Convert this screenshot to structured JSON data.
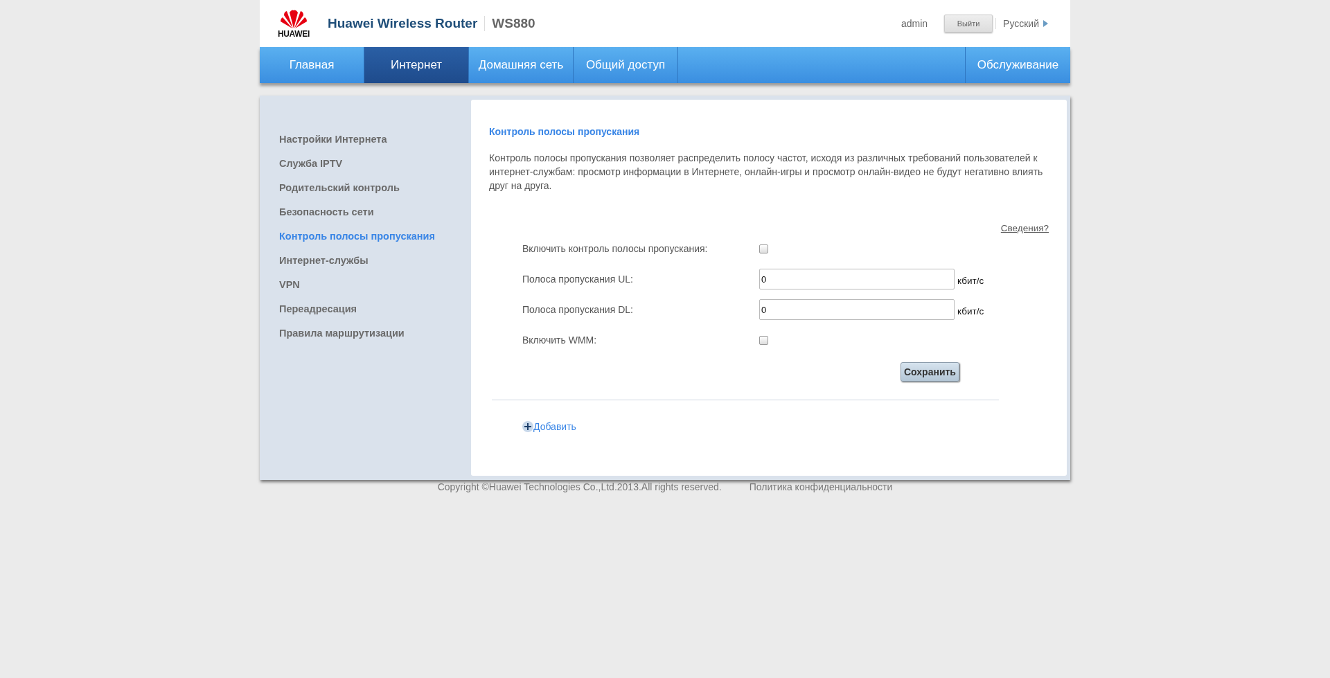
{
  "header": {
    "logo_text": "HUAWEI",
    "product": "Huawei Wireless Router",
    "model": "WS880",
    "user": "admin",
    "logout": "Выйти",
    "language": "Русский"
  },
  "tabs": [
    {
      "label": "Главная",
      "selected": false,
      "kind": "main"
    },
    {
      "label": "Интернет",
      "selected": true,
      "kind": "main"
    },
    {
      "label": "Домашняя сеть",
      "selected": false,
      "kind": "main"
    },
    {
      "label": "Общий доступ",
      "selected": false,
      "kind": "main"
    },
    {
      "label": "Обслуживание",
      "selected": false,
      "kind": "service"
    }
  ],
  "sidebar": {
    "items": [
      {
        "label": "Настройки Интернета",
        "selected": false
      },
      {
        "label": "Служба IPTV",
        "selected": false
      },
      {
        "label": "Родительский контроль",
        "selected": false
      },
      {
        "label": "Безопасность сети",
        "selected": false
      },
      {
        "label": "Контроль полосы пропускания",
        "selected": true
      },
      {
        "label": "Интернет-службы",
        "selected": false
      },
      {
        "label": "VPN",
        "selected": false
      },
      {
        "label": "Переадресация",
        "selected": false
      },
      {
        "label": "Правила маршрутизации",
        "selected": false
      }
    ]
  },
  "content": {
    "title": "Контроль полосы пропускания",
    "description": "Контроль полосы пропускания позволяет распределить полосу частот, исходя из различных требований пользователей к интернет-службам: просмотр информации в Интернете, онлайн-игры и просмотр онлайн-видео не будут негативно влиять друг на друга.",
    "help_link": "Сведения?",
    "fields": [
      {
        "kind": "checkbox",
        "label": "Включить контроль полосы пропускания:",
        "checked": false
      },
      {
        "kind": "text",
        "label": "Полоса пропускания UL:",
        "value": "0",
        "unit": "кбит/с"
      },
      {
        "kind": "text",
        "label": "Полоса пропускания DL:",
        "value": "0",
        "unit": "кбит/с"
      },
      {
        "kind": "checkbox",
        "label": "Включить WMM:",
        "checked": false
      }
    ],
    "save_button": "Сохранить",
    "add_link": "Добавить"
  },
  "footer": {
    "copyright": "Copyright ©Huawei Technologies Co.,Ltd.2013.All rights reserved.",
    "privacy_link": "Политика конфиденциальности"
  }
}
